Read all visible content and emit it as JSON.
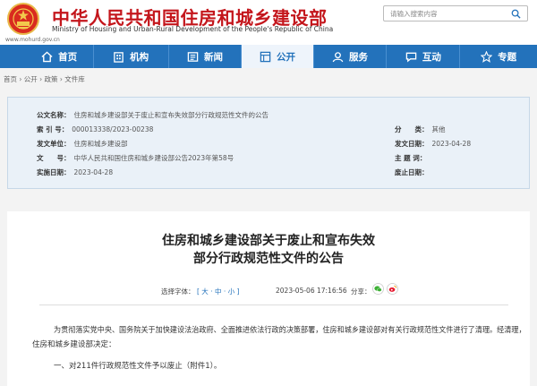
{
  "header": {
    "title": "中华人民共和国住房和城乡建设部",
    "subtitle": "Ministry of Housing and Urban-Rural Development of the People's Republic of China",
    "url": "www.mohurd.gov.cn",
    "search_placeholder": "请输入搜索内容"
  },
  "nav": {
    "items": [
      {
        "label": "首页",
        "icon": "home-icon"
      },
      {
        "label": "机构",
        "icon": "building-icon"
      },
      {
        "label": "新闻",
        "icon": "news-icon"
      },
      {
        "label": "公开",
        "icon": "open-icon"
      },
      {
        "label": "服务",
        "icon": "service-icon"
      },
      {
        "label": "互动",
        "icon": "interaction-icon"
      },
      {
        "label": "专题",
        "icon": "topic-icon"
      }
    ],
    "active": "公开"
  },
  "breadcrumb": "首页 › 公开 › 政策 › 文件库",
  "meta": {
    "title_label": "公文名称：",
    "title_value": "住房和城乡建设部关于废止和宣布失效部分行政规范性文件的公告",
    "index_label": "索 引 号：",
    "index_value": "000013338/2023-00238",
    "category_label": "分　　类：",
    "category_value": "其他",
    "issuer_label": "发文单位：",
    "issuer_value": "住房和城乡建设部",
    "date_label": "发文日期：",
    "date_value": "2023-04-28",
    "docno_label": "文　　号：",
    "docno_value": "中华人民共和国住房和城乡建设部公告2023年第58号",
    "topic_label": "主 题 词：",
    "effective_label": "实施日期：",
    "effective_value": "2023-04-28",
    "repeal_label": "废止日期："
  },
  "article": {
    "title_line1": "住房和城乡建设部关于废止和宣布失效",
    "title_line2": "部分行政规范性文件的公告",
    "font_select_label": "选择字体：",
    "font_options": "[ 大 · 中 · 小 ]",
    "publish_time": "2023-05-06 17:16:56",
    "share_label": "分享：",
    "para1_line1": "为贯彻落实党中央、国务院关于加快建设法治政府、全面推进依法行政的决策部署，住房和城乡建设部对有关行政规范性文件进行了清理。经清理，",
    "para1_line2": "住房和城乡建设部决定：",
    "para2": "一、对211件行政规范性文件予以废止（附件1）。"
  },
  "colors": {
    "brand_red": "#c4161c",
    "nav_blue": "#2372bb",
    "meta_bg": "#eaf1f8"
  }
}
